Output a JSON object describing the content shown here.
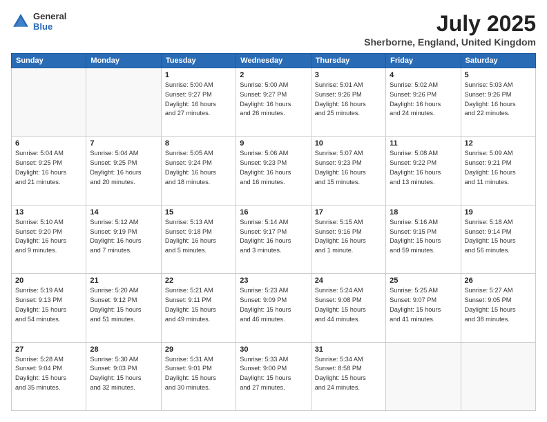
{
  "header": {
    "logo_top": "General",
    "logo_bottom": "Blue",
    "title": "July 2025",
    "subtitle": "Sherborne, England, United Kingdom"
  },
  "weekdays": [
    "Sunday",
    "Monday",
    "Tuesday",
    "Wednesday",
    "Thursday",
    "Friday",
    "Saturday"
  ],
  "weeks": [
    [
      {
        "day": "",
        "info": ""
      },
      {
        "day": "",
        "info": ""
      },
      {
        "day": "1",
        "info": "Sunrise: 5:00 AM\nSunset: 9:27 PM\nDaylight: 16 hours\nand 27 minutes."
      },
      {
        "day": "2",
        "info": "Sunrise: 5:00 AM\nSunset: 9:27 PM\nDaylight: 16 hours\nand 26 minutes."
      },
      {
        "day": "3",
        "info": "Sunrise: 5:01 AM\nSunset: 9:26 PM\nDaylight: 16 hours\nand 25 minutes."
      },
      {
        "day": "4",
        "info": "Sunrise: 5:02 AM\nSunset: 9:26 PM\nDaylight: 16 hours\nand 24 minutes."
      },
      {
        "day": "5",
        "info": "Sunrise: 5:03 AM\nSunset: 9:26 PM\nDaylight: 16 hours\nand 22 minutes."
      }
    ],
    [
      {
        "day": "6",
        "info": "Sunrise: 5:04 AM\nSunset: 9:25 PM\nDaylight: 16 hours\nand 21 minutes."
      },
      {
        "day": "7",
        "info": "Sunrise: 5:04 AM\nSunset: 9:25 PM\nDaylight: 16 hours\nand 20 minutes."
      },
      {
        "day": "8",
        "info": "Sunrise: 5:05 AM\nSunset: 9:24 PM\nDaylight: 16 hours\nand 18 minutes."
      },
      {
        "day": "9",
        "info": "Sunrise: 5:06 AM\nSunset: 9:23 PM\nDaylight: 16 hours\nand 16 minutes."
      },
      {
        "day": "10",
        "info": "Sunrise: 5:07 AM\nSunset: 9:23 PM\nDaylight: 16 hours\nand 15 minutes."
      },
      {
        "day": "11",
        "info": "Sunrise: 5:08 AM\nSunset: 9:22 PM\nDaylight: 16 hours\nand 13 minutes."
      },
      {
        "day": "12",
        "info": "Sunrise: 5:09 AM\nSunset: 9:21 PM\nDaylight: 16 hours\nand 11 minutes."
      }
    ],
    [
      {
        "day": "13",
        "info": "Sunrise: 5:10 AM\nSunset: 9:20 PM\nDaylight: 16 hours\nand 9 minutes."
      },
      {
        "day": "14",
        "info": "Sunrise: 5:12 AM\nSunset: 9:19 PM\nDaylight: 16 hours\nand 7 minutes."
      },
      {
        "day": "15",
        "info": "Sunrise: 5:13 AM\nSunset: 9:18 PM\nDaylight: 16 hours\nand 5 minutes."
      },
      {
        "day": "16",
        "info": "Sunrise: 5:14 AM\nSunset: 9:17 PM\nDaylight: 16 hours\nand 3 minutes."
      },
      {
        "day": "17",
        "info": "Sunrise: 5:15 AM\nSunset: 9:16 PM\nDaylight: 16 hours\nand 1 minute."
      },
      {
        "day": "18",
        "info": "Sunrise: 5:16 AM\nSunset: 9:15 PM\nDaylight: 15 hours\nand 59 minutes."
      },
      {
        "day": "19",
        "info": "Sunrise: 5:18 AM\nSunset: 9:14 PM\nDaylight: 15 hours\nand 56 minutes."
      }
    ],
    [
      {
        "day": "20",
        "info": "Sunrise: 5:19 AM\nSunset: 9:13 PM\nDaylight: 15 hours\nand 54 minutes."
      },
      {
        "day": "21",
        "info": "Sunrise: 5:20 AM\nSunset: 9:12 PM\nDaylight: 15 hours\nand 51 minutes."
      },
      {
        "day": "22",
        "info": "Sunrise: 5:21 AM\nSunset: 9:11 PM\nDaylight: 15 hours\nand 49 minutes."
      },
      {
        "day": "23",
        "info": "Sunrise: 5:23 AM\nSunset: 9:09 PM\nDaylight: 15 hours\nand 46 minutes."
      },
      {
        "day": "24",
        "info": "Sunrise: 5:24 AM\nSunset: 9:08 PM\nDaylight: 15 hours\nand 44 minutes."
      },
      {
        "day": "25",
        "info": "Sunrise: 5:25 AM\nSunset: 9:07 PM\nDaylight: 15 hours\nand 41 minutes."
      },
      {
        "day": "26",
        "info": "Sunrise: 5:27 AM\nSunset: 9:05 PM\nDaylight: 15 hours\nand 38 minutes."
      }
    ],
    [
      {
        "day": "27",
        "info": "Sunrise: 5:28 AM\nSunset: 9:04 PM\nDaylight: 15 hours\nand 35 minutes."
      },
      {
        "day": "28",
        "info": "Sunrise: 5:30 AM\nSunset: 9:03 PM\nDaylight: 15 hours\nand 32 minutes."
      },
      {
        "day": "29",
        "info": "Sunrise: 5:31 AM\nSunset: 9:01 PM\nDaylight: 15 hours\nand 30 minutes."
      },
      {
        "day": "30",
        "info": "Sunrise: 5:33 AM\nSunset: 9:00 PM\nDaylight: 15 hours\nand 27 minutes."
      },
      {
        "day": "31",
        "info": "Sunrise: 5:34 AM\nSunset: 8:58 PM\nDaylight: 15 hours\nand 24 minutes."
      },
      {
        "day": "",
        "info": ""
      },
      {
        "day": "",
        "info": ""
      }
    ]
  ]
}
